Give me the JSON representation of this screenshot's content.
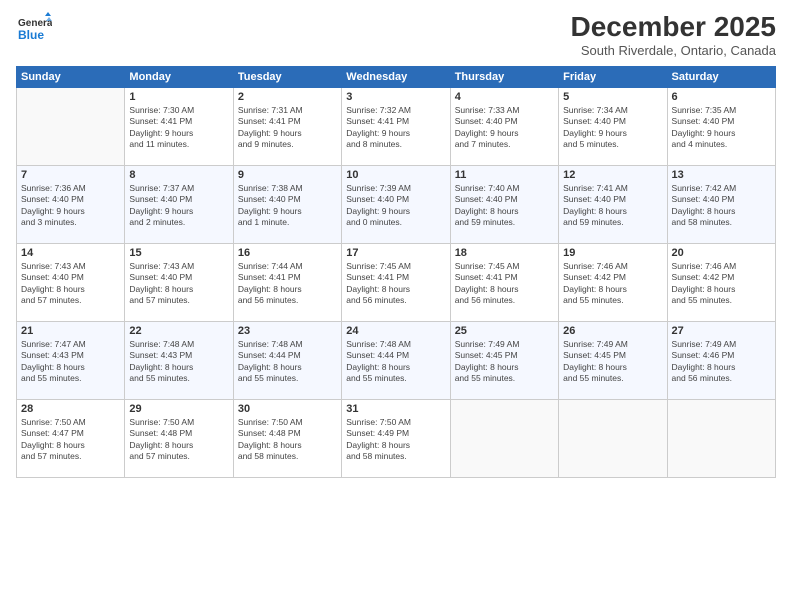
{
  "header": {
    "logo_line1": "General",
    "logo_line2": "Blue",
    "month": "December 2025",
    "location": "South Riverdale, Ontario, Canada"
  },
  "weekdays": [
    "Sunday",
    "Monday",
    "Tuesday",
    "Wednesday",
    "Thursday",
    "Friday",
    "Saturday"
  ],
  "weeks": [
    [
      {
        "day": "",
        "info": ""
      },
      {
        "day": "1",
        "info": "Sunrise: 7:30 AM\nSunset: 4:41 PM\nDaylight: 9 hours\nand 11 minutes."
      },
      {
        "day": "2",
        "info": "Sunrise: 7:31 AM\nSunset: 4:41 PM\nDaylight: 9 hours\nand 9 minutes."
      },
      {
        "day": "3",
        "info": "Sunrise: 7:32 AM\nSunset: 4:41 PM\nDaylight: 9 hours\nand 8 minutes."
      },
      {
        "day": "4",
        "info": "Sunrise: 7:33 AM\nSunset: 4:40 PM\nDaylight: 9 hours\nand 7 minutes."
      },
      {
        "day": "5",
        "info": "Sunrise: 7:34 AM\nSunset: 4:40 PM\nDaylight: 9 hours\nand 5 minutes."
      },
      {
        "day": "6",
        "info": "Sunrise: 7:35 AM\nSunset: 4:40 PM\nDaylight: 9 hours\nand 4 minutes."
      }
    ],
    [
      {
        "day": "7",
        "info": "Sunrise: 7:36 AM\nSunset: 4:40 PM\nDaylight: 9 hours\nand 3 minutes."
      },
      {
        "day": "8",
        "info": "Sunrise: 7:37 AM\nSunset: 4:40 PM\nDaylight: 9 hours\nand 2 minutes."
      },
      {
        "day": "9",
        "info": "Sunrise: 7:38 AM\nSunset: 4:40 PM\nDaylight: 9 hours\nand 1 minute."
      },
      {
        "day": "10",
        "info": "Sunrise: 7:39 AM\nSunset: 4:40 PM\nDaylight: 9 hours\nand 0 minutes."
      },
      {
        "day": "11",
        "info": "Sunrise: 7:40 AM\nSunset: 4:40 PM\nDaylight: 8 hours\nand 59 minutes."
      },
      {
        "day": "12",
        "info": "Sunrise: 7:41 AM\nSunset: 4:40 PM\nDaylight: 8 hours\nand 59 minutes."
      },
      {
        "day": "13",
        "info": "Sunrise: 7:42 AM\nSunset: 4:40 PM\nDaylight: 8 hours\nand 58 minutes."
      }
    ],
    [
      {
        "day": "14",
        "info": "Sunrise: 7:43 AM\nSunset: 4:40 PM\nDaylight: 8 hours\nand 57 minutes."
      },
      {
        "day": "15",
        "info": "Sunrise: 7:43 AM\nSunset: 4:40 PM\nDaylight: 8 hours\nand 57 minutes."
      },
      {
        "day": "16",
        "info": "Sunrise: 7:44 AM\nSunset: 4:41 PM\nDaylight: 8 hours\nand 56 minutes."
      },
      {
        "day": "17",
        "info": "Sunrise: 7:45 AM\nSunset: 4:41 PM\nDaylight: 8 hours\nand 56 minutes."
      },
      {
        "day": "18",
        "info": "Sunrise: 7:45 AM\nSunset: 4:41 PM\nDaylight: 8 hours\nand 56 minutes."
      },
      {
        "day": "19",
        "info": "Sunrise: 7:46 AM\nSunset: 4:42 PM\nDaylight: 8 hours\nand 55 minutes."
      },
      {
        "day": "20",
        "info": "Sunrise: 7:46 AM\nSunset: 4:42 PM\nDaylight: 8 hours\nand 55 minutes."
      }
    ],
    [
      {
        "day": "21",
        "info": "Sunrise: 7:47 AM\nSunset: 4:43 PM\nDaylight: 8 hours\nand 55 minutes."
      },
      {
        "day": "22",
        "info": "Sunrise: 7:48 AM\nSunset: 4:43 PM\nDaylight: 8 hours\nand 55 minutes."
      },
      {
        "day": "23",
        "info": "Sunrise: 7:48 AM\nSunset: 4:44 PM\nDaylight: 8 hours\nand 55 minutes."
      },
      {
        "day": "24",
        "info": "Sunrise: 7:48 AM\nSunset: 4:44 PM\nDaylight: 8 hours\nand 55 minutes."
      },
      {
        "day": "25",
        "info": "Sunrise: 7:49 AM\nSunset: 4:45 PM\nDaylight: 8 hours\nand 55 minutes."
      },
      {
        "day": "26",
        "info": "Sunrise: 7:49 AM\nSunset: 4:45 PM\nDaylight: 8 hours\nand 55 minutes."
      },
      {
        "day": "27",
        "info": "Sunrise: 7:49 AM\nSunset: 4:46 PM\nDaylight: 8 hours\nand 56 minutes."
      }
    ],
    [
      {
        "day": "28",
        "info": "Sunrise: 7:50 AM\nSunset: 4:47 PM\nDaylight: 8 hours\nand 57 minutes."
      },
      {
        "day": "29",
        "info": "Sunrise: 7:50 AM\nSunset: 4:48 PM\nDaylight: 8 hours\nand 57 minutes."
      },
      {
        "day": "30",
        "info": "Sunrise: 7:50 AM\nSunset: 4:48 PM\nDaylight: 8 hours\nand 58 minutes."
      },
      {
        "day": "31",
        "info": "Sunrise: 7:50 AM\nSunset: 4:49 PM\nDaylight: 8 hours\nand 58 minutes."
      },
      {
        "day": "",
        "info": ""
      },
      {
        "day": "",
        "info": ""
      },
      {
        "day": "",
        "info": ""
      }
    ]
  ]
}
